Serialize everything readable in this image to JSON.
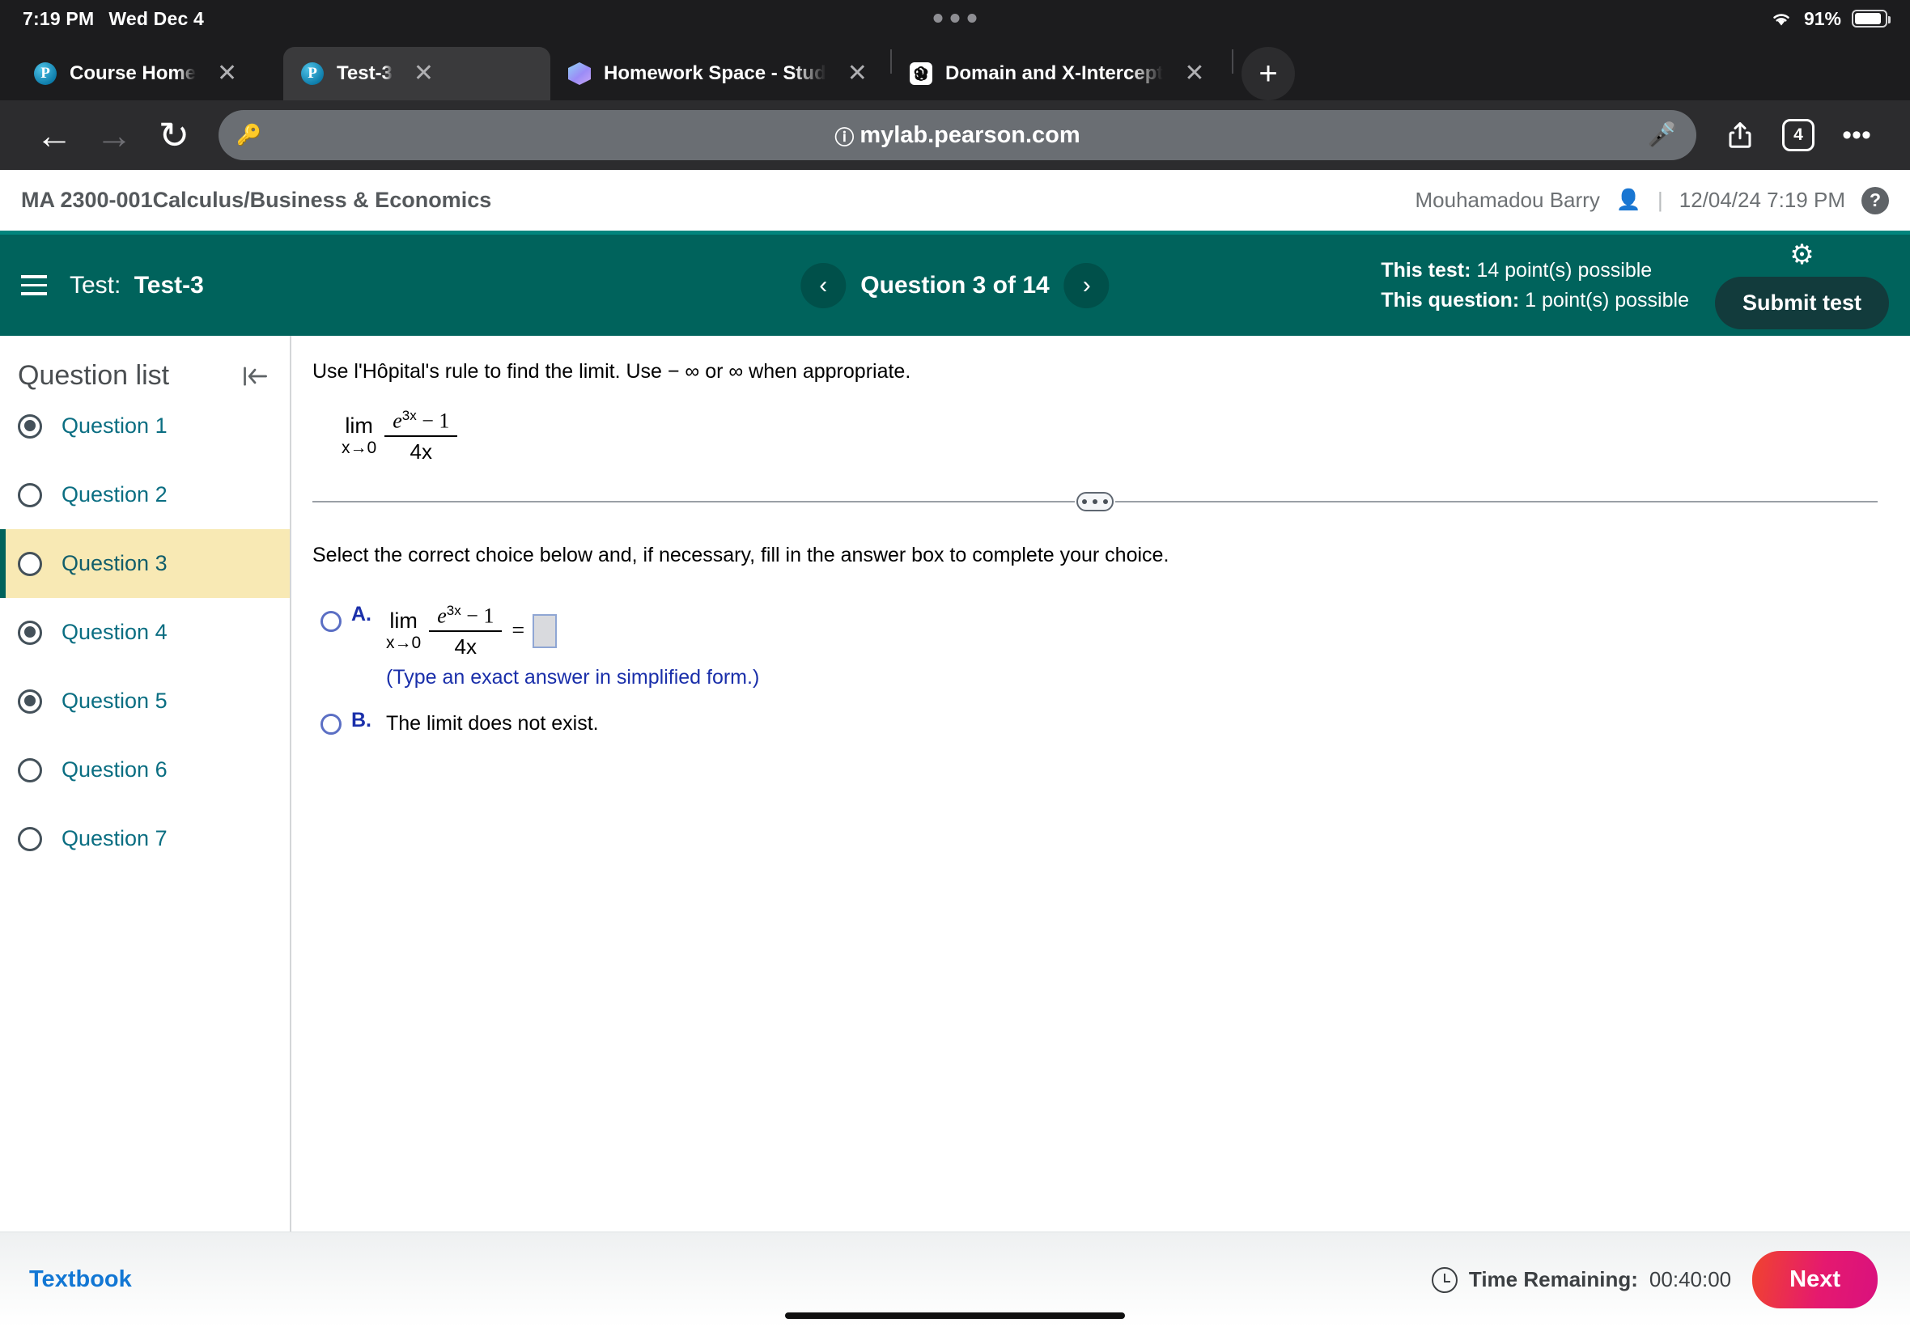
{
  "status_bar": {
    "time": "7:19 PM",
    "date": "Wed Dec 4",
    "battery_percent": "91%",
    "wifi_icon": "wifi-icon",
    "battery_icon": "battery-icon"
  },
  "browser": {
    "tabs": [
      {
        "title": "Course Home",
        "favicon": "pearson-icon",
        "active": false
      },
      {
        "title": "Test-3",
        "favicon": "pearson-icon",
        "active": true
      },
      {
        "title": "Homework Space - Stud",
        "favicon": "homework-space-icon",
        "active": false
      },
      {
        "title": "Domain and X-Intercept",
        "favicon": "chatgpt-icon",
        "active": false
      }
    ],
    "new_tab_label": "+",
    "close_label": "✕",
    "back_label": "←",
    "forward_label": "→",
    "reload_label": "↻",
    "url": "mylab.pearson.com",
    "url_prefix_icon": "info-circle-icon",
    "password_icon": "key-icon",
    "mic_icon": "microphone-icon",
    "share_icon": "share-icon",
    "tab_count": "4",
    "more_label": "•••"
  },
  "course_header": {
    "course_title": "MA 2300-001Calculus/Business & Economics",
    "user_name": "Mouhamadou Barry",
    "user_icon": "person-icon",
    "separator": "|",
    "datetime": "12/04/24 7:19 PM",
    "help_label": "?"
  },
  "test_header": {
    "menu_icon": "hamburger-menu-icon",
    "test_prefix": "Test:",
    "test_name": "Test-3",
    "prev_label": "‹",
    "next_label": "›",
    "question_counter": "Question 3 of 14",
    "test_points_label": "This test:",
    "test_points_value": "14 point(s) possible",
    "question_points_label": "This question:",
    "question_points_value": "1 point(s) possible",
    "settings_icon": "gear-icon",
    "submit_label": "Submit test"
  },
  "sidebar": {
    "title": "Question list",
    "collapse_icon": "collapse-panel-icon",
    "items": [
      {
        "label": "Question 1",
        "answered": true,
        "current": false
      },
      {
        "label": "Question 2",
        "answered": false,
        "current": false
      },
      {
        "label": "Question 3",
        "answered": false,
        "current": true
      },
      {
        "label": "Question 4",
        "answered": true,
        "current": false
      },
      {
        "label": "Question 5",
        "answered": true,
        "current": false
      },
      {
        "label": "Question 6",
        "answered": false,
        "current": false
      },
      {
        "label": "Question 7",
        "answered": false,
        "current": false
      }
    ]
  },
  "question": {
    "prompt": "Use l'Hôpital's rule to find the limit. Use − ∞ or ∞ when appropriate.",
    "expression": {
      "lim_word": "lim",
      "lim_sub": "x→0",
      "numerator_base": "e",
      "numerator_exponent": "3x",
      "numerator_rest": "− 1",
      "denominator": "4x"
    },
    "divider_handle_icon": "drag-handle-icon",
    "choice_instruction": "Select the correct choice below and, if necessary, fill in the answer box to complete your choice.",
    "choices": [
      {
        "letter": "A.",
        "type": "math_with_input",
        "lim_word": "lim",
        "lim_sub": "x→0",
        "numerator_base": "e",
        "numerator_exponent": "3x",
        "numerator_rest": "− 1",
        "denominator": "4x",
        "equals": "=",
        "answer_value": "",
        "hint": "(Type an exact answer in simplified form.)",
        "selected": false
      },
      {
        "letter": "B.",
        "type": "text",
        "text": "The limit does not exist.",
        "selected": false
      }
    ]
  },
  "bottom_bar": {
    "textbook_label": "Textbook",
    "clock_icon": "clock-icon",
    "timer_label": "Time Remaining:",
    "timer_value": "00:40:00",
    "next_label": "Next"
  },
  "colors": {
    "teal": "#00635c",
    "teal_accent": "#00857d",
    "highlight_yellow": "#f8e9b4",
    "link_blue": "#0a6e82",
    "choice_blue": "#1a2faa",
    "next_gradient_start": "#f0442e",
    "next_gradient_end": "#d9117e"
  }
}
